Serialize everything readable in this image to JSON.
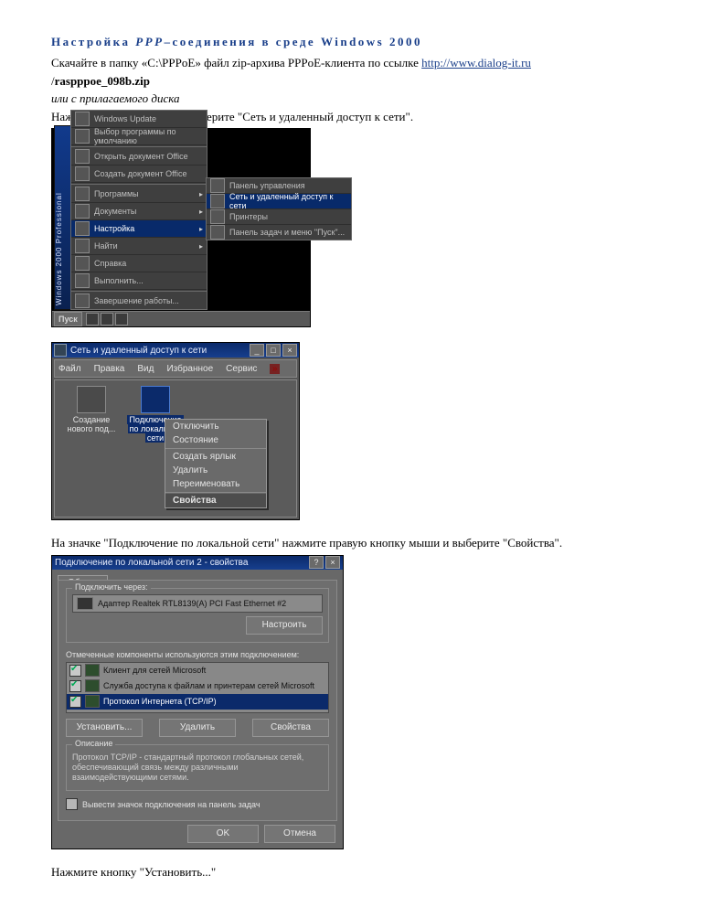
{
  "title_pre": "Настройка ",
  "title_ppp": "PPP",
  "title_post": "–соединения в среде Windows 2000",
  "intro_pre": "Скачайте в папку «C:\\PPPoE» файл zip-архива PPPoE-клиента по ссылке  ",
  "intro_link": "http://www.dialog-it.ru",
  "intro_zip_slash": "/",
  "intro_zip": "raspppoe_098b.zip",
  "intro_cd": "или с прилагаемого диска",
  "step1": "Нажмите кнопку \"Пуск\" и выберите \"Сеть и удаленный доступ к сети\".",
  "step2": "На значке \"Подключение по локальной сети\" нажмите правую кнопку мыши и выберите \"Свойства\".",
  "step3": "Нажмите кнопку \"Установить...\"",
  "s1": {
    "sidebar": "Windows 2000 Professional",
    "start": "Пуск",
    "items": [
      "Windows Update",
      "Выбор программы по умолчанию",
      "Открыть документ Office",
      "Создать документ Office",
      "Программы",
      "Документы",
      "Настройка",
      "Найти",
      "Справка",
      "Выполнить...",
      "Завершение работы..."
    ],
    "sub": [
      "Панель управления",
      "Сеть и удаленный доступ к сети",
      "Принтеры",
      "Панель задач и меню \"Пуск\"..."
    ]
  },
  "s2": {
    "title": "Сеть и удаленный доступ к сети",
    "menu": [
      "Файл",
      "Правка",
      "Вид",
      "Избранное",
      "Сервис"
    ],
    "icon1": "Создание нового под...",
    "icon2a": "Подключение",
    "icon2b": "по локальной",
    "icon2c": "сети",
    "ctx": [
      "Отключить",
      "Состояние",
      "Создать ярлык",
      "Удалить",
      "Переименовать",
      "Свойства"
    ]
  },
  "s3": {
    "title": "Подключение по локальной сети 2 - свойства",
    "tab": "Общие",
    "g1": "Подключить через:",
    "adapter": "Адаптер Realtek RTL8139(A) PCI Fast Ethernet #2",
    "configure": "Настроить",
    "g2": "Отмеченные компоненты используются этим подключением:",
    "comp": [
      "Клиент для сетей Microsoft",
      "Служба доступа к файлам и принтерам сетей Microsoft",
      "Протокол Интернета (TCP/IP)"
    ],
    "install": "Установить...",
    "remove": "Удалить",
    "props": "Свойства",
    "g3": "Описание",
    "desc": "Протокол TCP/IP - стандартный протокол глобальных сетей, обеспечивающий связь между различными взаимодействующими сетями.",
    "show": "Вывести значок подключения на панель задач",
    "ok": "OK",
    "cancel": "Отмена"
  }
}
